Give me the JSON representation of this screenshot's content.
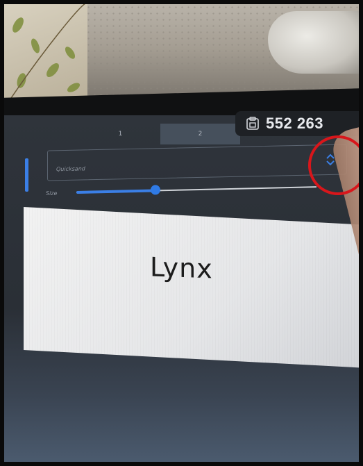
{
  "tabs": [
    {
      "label": "1"
    },
    {
      "label": "2"
    }
  ],
  "counter": {
    "icon": "badge-icon",
    "value": "552 263"
  },
  "font_select": {
    "value": "Quicksand",
    "icon": "chevron-up-down-icon"
  },
  "size": {
    "label": "Size",
    "value_fraction": 0.33
  },
  "preview": {
    "text": "Lynx"
  },
  "colors": {
    "accent": "#3b7fe6",
    "annotation": "#d8161b"
  }
}
